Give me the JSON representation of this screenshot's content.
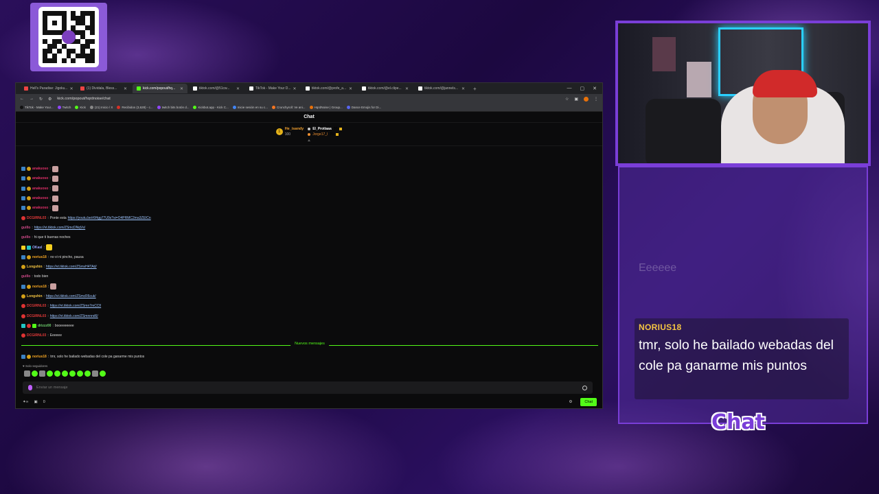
{
  "tabs": [
    {
      "label": "Hell's Paradise: Jigoku...",
      "active": false
    },
    {
      "label": "(1) Dividala, Bless...",
      "active": false
    },
    {
      "label": "kick.com/popout/hq...",
      "active": true
    },
    {
      "label": "tiktok.com/@51cw...",
      "active": false
    },
    {
      "label": "TikTok - Make Your D...",
      "active": false
    },
    {
      "label": "tiktok.com/@profe_a...",
      "active": false
    },
    {
      "label": "tiktok.com/@el.clipe...",
      "active": false
    },
    {
      "label": "tiktok.com/@jannels...",
      "active": false
    }
  ],
  "url": "kick.com/popout/hqrdnoise/chat",
  "bookmarks": [
    "TikTok - Make Your...",
    "Twitch",
    "Kick",
    "(21) Inicio / X",
    "Recibidos (3,628) - c...",
    "twitch bits botón d...",
    "Kickbot.app - Kick C...",
    "Inicie sesión en su c...",
    "Crunchyroll: Ve ani...",
    "HqrdNoise | Group...",
    "Dance Emojis for Di..."
  ],
  "chat": {
    "title": "Chat",
    "top_gifter": {
      "name": "He_isandy",
      "value": "100"
    },
    "gifters": [
      {
        "name": "El_Prottaaa",
        "value": "90"
      },
      {
        "name": "Jorge17_l",
        "value": "70"
      }
    ],
    "messages": [
      {
        "user": "anakuoso",
        "text": ""
      },
      {
        "user": "anakuoso",
        "text": ""
      },
      {
        "user": "anakuoso",
        "text": ""
      },
      {
        "user": "anakuoso",
        "text": ""
      },
      {
        "user": "anakuoso",
        "text": ""
      },
      {
        "user": "DCGIRNL03",
        "text": "Ponte esta ",
        "link": "https://youtu.be/r6Hgg77U9s?si=O4PRMC2ma3ZEICn"
      },
      {
        "user": "guillo",
        "text": "",
        "link": "https://vt.tiktok.com/ZSmcDNqVs/"
      },
      {
        "user": "guillo",
        "text": "hi que ti buenas noches"
      },
      {
        "user": "OKasl",
        "text": ""
      },
      {
        "user": "norius18",
        "text": "no vi ni pincho, pausa"
      },
      {
        "user": "Longshin",
        "text": "",
        "link": "https://vt.tiktok.com/ZSmvH4TAd/"
      },
      {
        "user": "guillo",
        "text": "todo bien"
      },
      {
        "user": "norius18",
        "text": ""
      },
      {
        "user": "Longshin",
        "text": "",
        "link": "https://vt.tiktok.com/ZSmcR6cuk/"
      },
      {
        "user": "DCGIRNL03",
        "text": "",
        "link": "https://vt.tiktok.com/ZSmn7mCCf/"
      },
      {
        "user": "DCGIRNL03",
        "text": "",
        "link": "https://vt.tiktok.com/ZSmnnnd6/"
      },
      {
        "user": "drizzz00",
        "text": "booeeeeeee"
      },
      {
        "user": "DCGIRNL03",
        "text": "Eeeeee"
      }
    ],
    "new_messages_label": "Nuevos mensajes",
    "new_message": {
      "user": "norius18",
      "text": "tmr, solo he bailado webadas del cole pa ganarme mis puntos"
    },
    "followers_only": "Solo seguidores",
    "input_placeholder": "Enviar un mensaje",
    "points": "0",
    "send_label": "Chat"
  },
  "overlay": {
    "ghost_text": "Eeeeee",
    "highlight_user": "NORIUS18",
    "highlight_msg": "tmr, solo he bailado webadas del cole pa ganarme mis puntos",
    "chat_label": "Chat"
  },
  "colors": {
    "accent": "#53fc18",
    "frame": "#7a3ed8",
    "username_gold": "#f5c542"
  }
}
